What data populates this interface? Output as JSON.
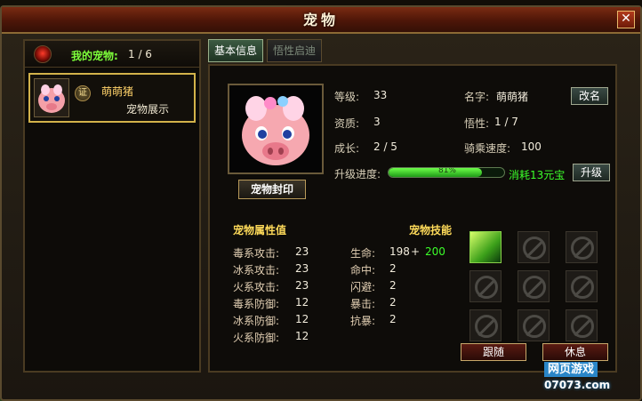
{
  "window": {
    "title": "宠物",
    "close_label": "✕"
  },
  "left": {
    "my_pets_label": "我的宠物:",
    "my_pets_count": "1 / 6",
    "pets": [
      {
        "badge": "证",
        "name": "萌萌猪",
        "action": "宠物展示"
      }
    ]
  },
  "tabs": [
    {
      "label": "基本信息",
      "active": true
    },
    {
      "label": "悟性启迪",
      "active": false
    }
  ],
  "basic": {
    "level_label": "等级:",
    "level": "33",
    "name_label": "名字:",
    "name": "萌萌猪",
    "rename_button": "改名",
    "quality_label": "资质:",
    "quality": "3",
    "savvy_label": "悟性:",
    "savvy": "1 / 7",
    "growth_label": "成长:",
    "growth": "2 / 5",
    "ride_speed_label": "骑乘速度:",
    "ride_speed": "100",
    "exp_label": "升级进度:",
    "exp_percent": 81,
    "exp_text": "81%",
    "cost_text": "消耗13元宝",
    "upgrade_button": "升级",
    "seal_button": "宠物封印"
  },
  "attributes": {
    "title": "宠物属性值",
    "items": [
      {
        "label": "毒系攻击:",
        "value": "23"
      },
      {
        "label": "冰系攻击:",
        "value": "23"
      },
      {
        "label": "火系攻击:",
        "value": "23"
      },
      {
        "label": "毒系防御:",
        "value": "12"
      },
      {
        "label": "冰系防御:",
        "value": "12"
      },
      {
        "label": "火系防御:",
        "value": "12"
      }
    ],
    "stats": [
      {
        "label": "生命:",
        "value": "198",
        "plus": "+",
        "bonus": "200"
      },
      {
        "label": "命中:",
        "value": "2"
      },
      {
        "label": "闪避:",
        "value": "2"
      },
      {
        "label": "暴击:",
        "value": "2"
      },
      {
        "label": "抗暴:",
        "value": "2"
      }
    ]
  },
  "skills": {
    "title": "宠物技能"
  },
  "actions": {
    "follow_button": "跟随",
    "rest_button": "休息"
  },
  "watermark": {
    "line1": "网页游戏",
    "line2": "07073.com"
  },
  "colors": {
    "accent_green": "#7dff3a",
    "gold": "#ffdb5a",
    "title_bar": "#4d1608"
  }
}
